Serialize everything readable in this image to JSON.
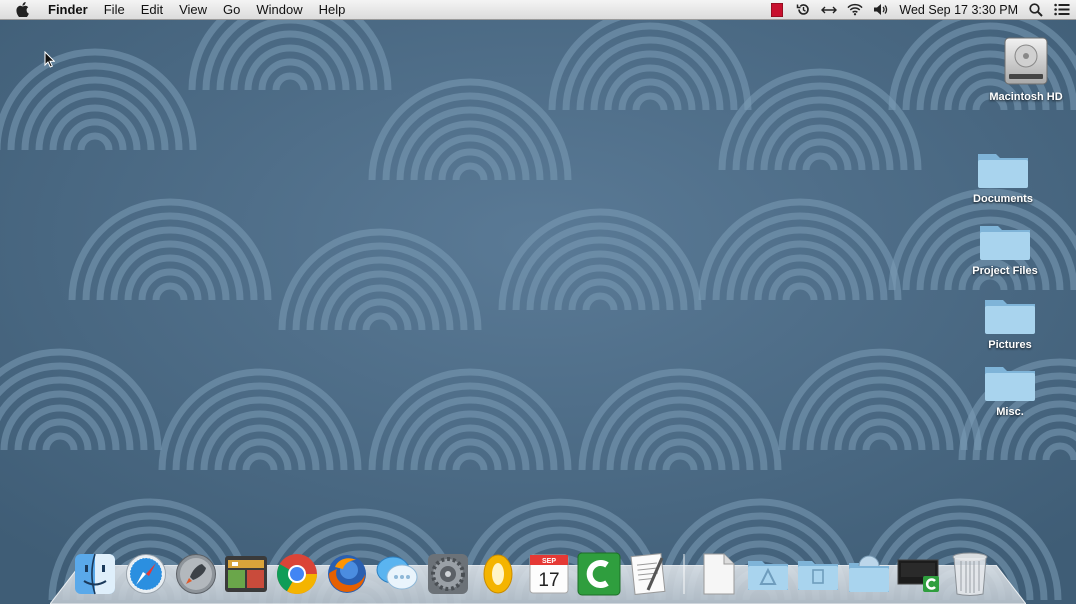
{
  "menubar": {
    "app_name": "Finder",
    "menus": [
      "File",
      "Edit",
      "View",
      "Go",
      "Window",
      "Help"
    ],
    "clock": "Wed Sep 17  3:30 PM"
  },
  "desktop_icons": {
    "hd": "Macintosh HD",
    "documents": "Documents",
    "project_files": "Project Files",
    "pictures": "Pictures",
    "misc": "Misc."
  },
  "dock": {
    "calendar_month": "SEP",
    "calendar_day": "17",
    "apps": [
      "finder",
      "safari",
      "launchpad",
      "photo-booth",
      "chrome",
      "firefox",
      "messages",
      "system-preferences",
      "outlook",
      "calendar",
      "camtasia",
      "textedit"
    ],
    "right_items": [
      "document",
      "applications-folder",
      "documents-folder",
      "downloads-folder",
      "camtasia-recorder",
      "trash"
    ]
  },
  "colors": {
    "wallpaper": "#4f6f8a",
    "menubar": "#e8e8e8",
    "folder": "#9dcbe8"
  }
}
